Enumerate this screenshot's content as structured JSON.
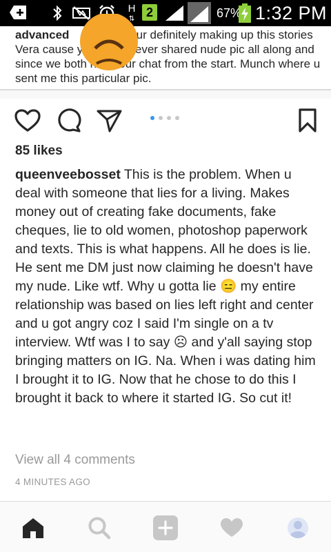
{
  "status_bar": {
    "battery_percent": "67%",
    "time": "1:32 PM",
    "network_label": "H",
    "sim_badge": "2",
    "icons": [
      "add-icon",
      "bluetooth-icon",
      "mute-icon",
      "alarm-icon",
      "network-h-icon",
      "sim-2-icon",
      "signal-icon",
      "signal-icon-2",
      "battery-charging-icon"
    ]
  },
  "previous_comment": {
    "username_fragment": "advanced",
    "text": "Your definitely making up this stories Vera cause you and I never shared nude pic all along and since we both have our chat from the start. Munch where u sent me this particular pic.",
    "emoji": "angry-face-emoji"
  },
  "post": {
    "likes": "85 likes",
    "carousel": {
      "count": 4,
      "active_index": 0
    },
    "caption_user": "queenveebosset",
    "caption_parts": [
      "This is the problem. When u deal with someone that lies for a living. Makes money out of creating fake documents, fake cheques, lie to old women, photoshop paperwork and texts. This is what happens. All he does is lie. He sent me DM just now claiming he doesn't have my nude. Like wtf. Why u gotta lie ",
      " my entire relationship was based on lies left right and center and u got angry coz I said I'm single on a tv interview. Wtf was I to say ",
      " and y'all saying stop bringing matters on IG. Na. When i was dating him I brought it to IG. Now that he chose  to do this I brought it back to where it started IG. So cut it!"
    ],
    "caption_emojis": [
      "😑",
      "☹"
    ],
    "view_comments": "View all 4 comments",
    "timestamp": "4 MINUTES AGO"
  },
  "colors": {
    "accent": "#3897f0",
    "text": "#262626",
    "muted": "#999999"
  },
  "bottom_nav": {
    "items": [
      "home-icon",
      "search-icon",
      "add-post-icon",
      "activity-heart-icon",
      "profile-avatar-icon"
    ],
    "active": "home-icon"
  }
}
